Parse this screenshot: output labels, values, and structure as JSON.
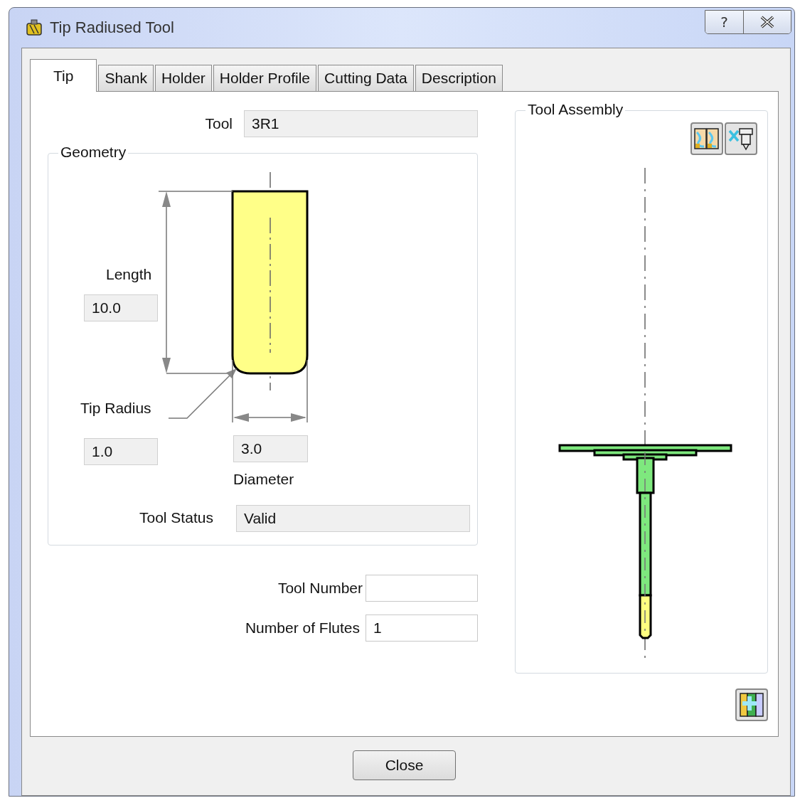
{
  "window": {
    "title": "Tip Radiused Tool",
    "help_button": "?"
  },
  "tabs": [
    {
      "label": "Tip",
      "selected": true
    },
    {
      "label": "Shank",
      "selected": false
    },
    {
      "label": "Holder",
      "selected": false
    },
    {
      "label": "Holder Profile",
      "selected": false
    },
    {
      "label": "Cutting Data",
      "selected": false
    },
    {
      "label": "Description",
      "selected": false
    }
  ],
  "tool": {
    "label": "Tool",
    "value": "3R1",
    "readonly": true
  },
  "geometry": {
    "title": "Geometry",
    "length": {
      "label": "Length",
      "value": "10.0",
      "readonly": true
    },
    "tip_radius": {
      "label": "Tip Radius",
      "value": "1.0",
      "readonly": true
    },
    "diameter": {
      "label": "Diameter",
      "value": "3.0",
      "readonly": true
    },
    "tool_status": {
      "label": "Tool Status",
      "value": "Valid",
      "readonly": true
    }
  },
  "tool_number": {
    "label": "Tool Number",
    "readonly": false
  },
  "number_of_flutes": {
    "label": "Number of Flutes",
    "value": "1",
    "readonly": false
  },
  "tool_assembly": {
    "title": "Tool Assembly"
  },
  "buttons": [
    "Close"
  ]
}
